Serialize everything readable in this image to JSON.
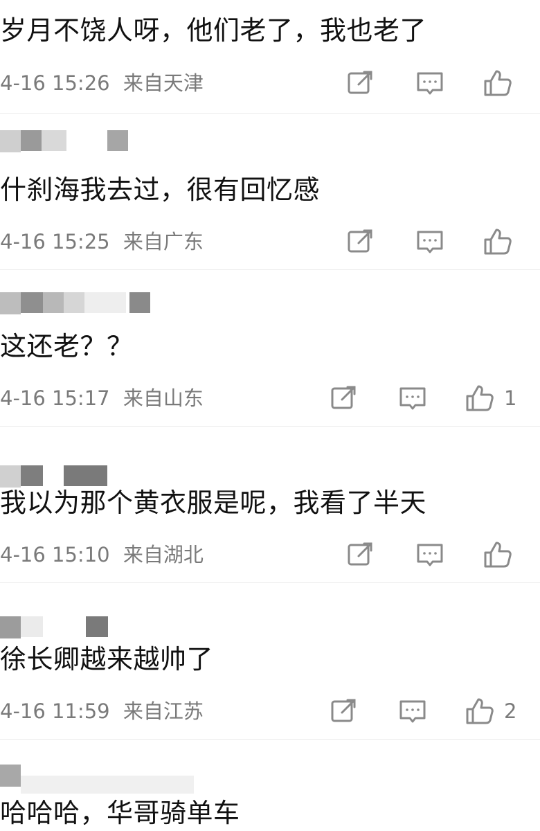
{
  "comments": [
    {
      "text": "岁月不饶人呀，他们老了，我也老了",
      "time": "4-16 15:26",
      "location": "来自天津",
      "likes": ""
    },
    {
      "text": "什刹海我去过，很有回忆感",
      "time": "4-16 15:25",
      "location": "来自广东",
      "likes": ""
    },
    {
      "text": "这还老？？",
      "time": "4-16 15:17",
      "location": "来自山东",
      "likes": "1"
    },
    {
      "text": "我以为那个黄衣服是呢，我看了半天",
      "time": "4-16 15:10",
      "location": "来自湖北",
      "likes": ""
    },
    {
      "text": "徐长卿越来越帅了",
      "time": "4-16 11:59",
      "location": "来自江苏",
      "likes": "2"
    },
    {
      "text": "哈哈哈，华哥骑单车",
      "time": "",
      "location": "",
      "likes": ""
    }
  ],
  "icons": {
    "share": "share-icon",
    "reply": "comment-icon",
    "like": "thumbs-up-icon"
  },
  "colors": {
    "meta": "#7a7a7a",
    "icon": "#8a8a8a",
    "divider": "#ececec"
  }
}
